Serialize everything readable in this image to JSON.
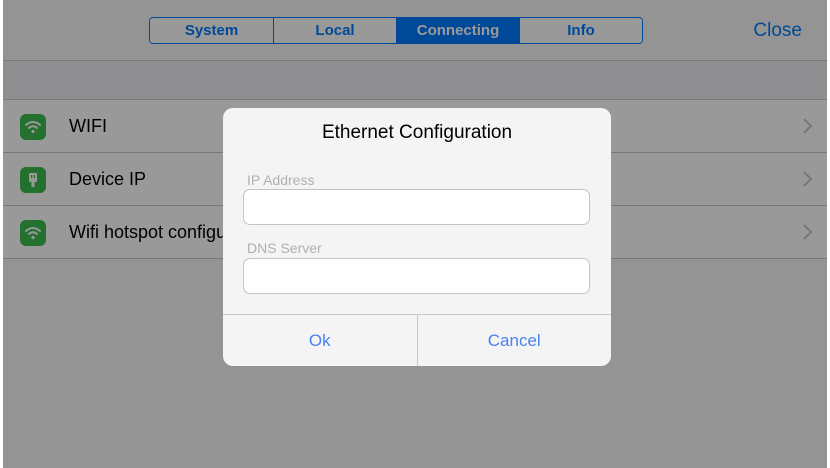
{
  "nav": {
    "tabs": [
      {
        "label": "System",
        "active": false
      },
      {
        "label": "Local",
        "active": false
      },
      {
        "label": "Connecting",
        "active": true
      },
      {
        "label": "Info",
        "active": false
      }
    ],
    "close_label": "Close"
  },
  "list": {
    "items": [
      {
        "label": "WIFI",
        "icon": "wifi-icon"
      },
      {
        "label": "Device IP",
        "icon": "ethernet-plug-icon"
      },
      {
        "label": "Wifi hotspot configuration",
        "icon": "wifi-icon"
      }
    ]
  },
  "dialog": {
    "title": "Ethernet Configuration",
    "ip_label": "IP Address",
    "ip_value": "",
    "dns_label": "DNS Server",
    "dns_value": "",
    "ok_label": "Ok",
    "cancel_label": "Cancel"
  },
  "colors": {
    "accent": "#007aff",
    "icon_green": "#3dbd4f",
    "dialog_button": "#4a80f0"
  }
}
